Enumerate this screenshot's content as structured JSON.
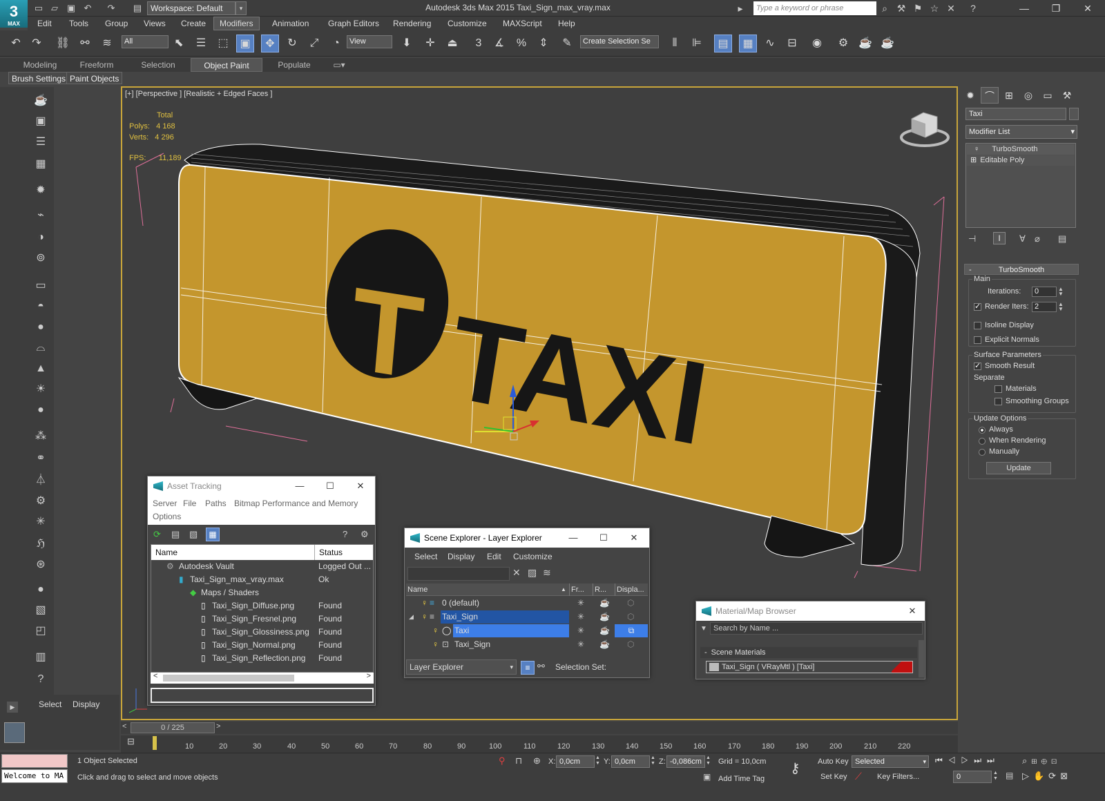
{
  "app": {
    "logo_text": "MAX",
    "workspace": "Workspace: Default",
    "title": "Autodesk 3ds Max  2015     Taxi_Sign_max_vray.max",
    "search_placeholder": "Type a keyword or phrase"
  },
  "menu": [
    "Edit",
    "Tools",
    "Group",
    "Views",
    "Create",
    "Modifiers",
    "Animation",
    "Graph Editors",
    "Rendering",
    "Customize",
    "MAXScript",
    "Help"
  ],
  "toolbar": {
    "filter": "All",
    "reference_coord": "View",
    "selection_set": "Create Selection Se"
  },
  "ribbon": {
    "tabs": [
      "Modeling",
      "Freeform",
      "Selection",
      "Object Paint",
      "Populate"
    ],
    "subtabs": [
      "Brush Settings",
      "Paint Objects"
    ]
  },
  "viewport": {
    "label": "[+] [Perspective ] [Realistic + Edged Faces ]",
    "stats_header": "Total",
    "polys_label": "Polys:",
    "polys": "4 168",
    "verts_label": "Verts:",
    "verts": "4 296",
    "fps_label": "FPS:",
    "fps": "11,189",
    "sign_text": "TAXI",
    "sign_color": "#c4962d"
  },
  "command_panel": {
    "object_name": "Taxi",
    "modifier_list": "Modifier List",
    "stack": [
      "TurboSmooth",
      "Editable Poly"
    ],
    "rollout": "TurboSmooth",
    "main_label": "Main",
    "iterations_label": "Iterations:",
    "iterations": "0",
    "render_iters_label": "Render Iters:",
    "render_iters": "2",
    "isoline": "Isoline Display",
    "explicit": "Explicit Normals",
    "surface_label": "Surface Parameters",
    "smooth_result": "Smooth Result",
    "separate_label": "Separate",
    "materials": "Materials",
    "smoothing_groups": "Smoothing Groups",
    "update_label": "Update Options",
    "always": "Always",
    "when_rendering": "When Rendering",
    "manually": "Manually",
    "update_button": "Update"
  },
  "asset_tracking": {
    "title": "Asset Tracking",
    "menu": [
      "Server",
      "File",
      "Paths",
      "Bitmap Performance and Memory",
      "Options"
    ],
    "col_name": "Name",
    "col_status": "Status",
    "rows": [
      {
        "name": "Autodesk Vault",
        "status": "Logged Out ..."
      },
      {
        "name": "Taxi_Sign_max_vray.max",
        "status": "Ok"
      },
      {
        "name": "Maps / Shaders",
        "status": ""
      },
      {
        "name": "Taxi_Sign_Diffuse.png",
        "status": "Found"
      },
      {
        "name": "Taxi_Sign_Fresnel.png",
        "status": "Found"
      },
      {
        "name": "Taxi_Sign_Glossiness.png",
        "status": "Found"
      },
      {
        "name": "Taxi_Sign_Normal.png",
        "status": "Found"
      },
      {
        "name": "Taxi_Sign_Reflection.png",
        "status": "Found"
      }
    ]
  },
  "scene_explorer": {
    "title": "Scene Explorer - Layer Explorer",
    "menu": [
      "Select",
      "Display",
      "Edit",
      "Customize"
    ],
    "cols": [
      "Name",
      "Fr...",
      "R...",
      "Displa..."
    ],
    "rows": [
      "0 (default)",
      "Taxi_Sign",
      "Taxi",
      "Taxi_Sign"
    ],
    "footer_combo": "Layer Explorer",
    "selection_set_label": "Selection Set:"
  },
  "material_browser": {
    "title": "Material/Map Browser",
    "search_placeholder": "Search by Name ...",
    "section": "Scene Materials",
    "item": "Taxi_Sign  ( VRayMtl )  [Taxi]"
  },
  "left_panel": {
    "select": "Select",
    "display": "Display"
  },
  "timeline": {
    "frame": "0 / 225",
    "ticks": [
      "10",
      "20",
      "30",
      "40",
      "50",
      "60",
      "70",
      "80",
      "90",
      "100",
      "110",
      "120",
      "130",
      "140",
      "150",
      "160",
      "170",
      "180",
      "190",
      "200",
      "210",
      "220"
    ]
  },
  "status": {
    "script": "Welcome to MA",
    "selected": "1 Object Selected",
    "prompt": "Click and drag to select and move objects",
    "x_label": "X:",
    "x": "0,0cm",
    "y_label": "Y:",
    "y": "0,0cm",
    "z_label": "Z:",
    "z": "-0,086cm",
    "grid": "Grid = 10,0cm",
    "add_time_tag": "Add Time Tag",
    "auto_key": "Auto Key",
    "set_key": "Set Key",
    "selected_combo": "Selected",
    "key_filters": "Key Filters...",
    "frame_field": "0"
  }
}
